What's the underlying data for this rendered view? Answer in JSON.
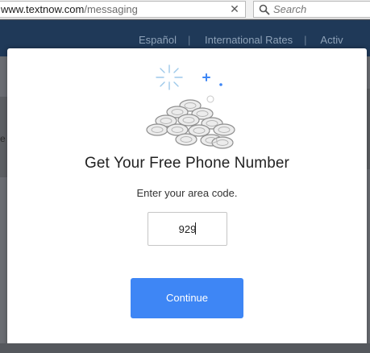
{
  "browser": {
    "url_domain": "www.textnow.com",
    "url_path": "/messaging",
    "search_placeholder": "Search",
    "clear_glyph": "✕"
  },
  "site_header": {
    "nav": [
      "Español",
      "International Rates",
      "Activ"
    ]
  },
  "background": {
    "left_glyph": "e"
  },
  "modal": {
    "title": "Get Your Free Phone Number",
    "subtitle": "Enter your area code.",
    "area_code_value": "929",
    "continue_label": "Continue",
    "illustration": "coins-sparkle-icon"
  },
  "colors": {
    "header_bg": "#1f3958",
    "continue_button": "#3e86f5",
    "sparkle": "#9ec9ea"
  }
}
